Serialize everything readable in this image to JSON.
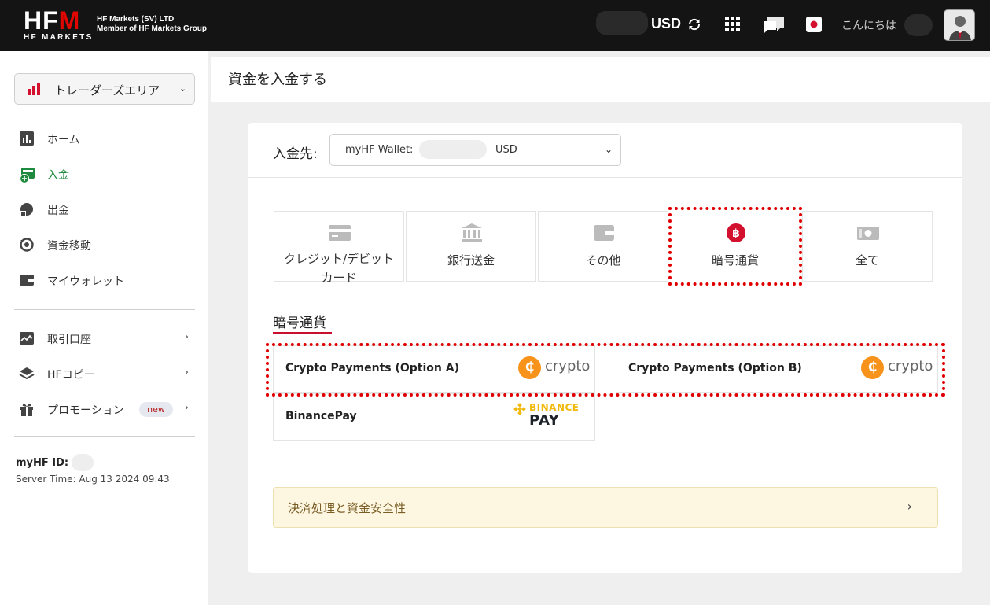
{
  "header": {
    "logo_text": "HFM",
    "logo_subtext": "HF MARKETS",
    "entity_line1": "HF Markets (SV) LTD",
    "entity_line2": "Member of HF Markets Group",
    "currency": "USD",
    "greeting": "こんにちは",
    "icons": [
      "refresh-icon",
      "apps-grid-icon",
      "chat-icon",
      "japan-flag-icon",
      "user-avatar"
    ]
  },
  "sidebar": {
    "area_button": "トレーダーズエリア",
    "items": [
      {
        "label": "ホーム",
        "icon": "chart-icon"
      },
      {
        "label": "入金",
        "icon": "deposit-wallet-icon",
        "active": true
      },
      {
        "label": "出金",
        "icon": "withdraw-icon"
      },
      {
        "label": "資金移動",
        "icon": "transfer-icon"
      },
      {
        "label": "マイウォレット",
        "icon": "wallet-icon"
      }
    ],
    "items2": [
      {
        "label": "取引口座",
        "icon": "trading-account-icon"
      },
      {
        "label": "HFコピー",
        "icon": "layers-icon"
      },
      {
        "label": "プロモーション",
        "icon": "gift-icon",
        "badge": "new"
      }
    ],
    "myhf_id_label": "myHF ID:",
    "server_time": "Server Time: Aug 13 2024 09:43"
  },
  "page": {
    "title": "資金を入金する"
  },
  "deposit": {
    "destination_label": "入金先:",
    "wallet_label": "myHF Wallet:",
    "wallet_currency": "USD",
    "tabs": [
      {
        "label": "クレジット/デビットカード",
        "icon": "credit-card-icon"
      },
      {
        "label": "銀行送金",
        "icon": "bank-icon"
      },
      {
        "label": "その他",
        "icon": "wallet-icon"
      },
      {
        "label": "暗号通貨",
        "icon": "bitcoin-icon",
        "selected": true
      },
      {
        "label": "全て",
        "icon": "cash-icon"
      }
    ],
    "section_title": "暗号通貨",
    "methods": [
      {
        "label": "Crypto Payments (Option A)",
        "logo_text": "crypto"
      },
      {
        "label": "Crypto Payments (Option B)",
        "logo_text": "crypto"
      },
      {
        "label": "BinancePay",
        "logo_line1": "BINANCE",
        "logo_line2": "PAY"
      }
    ],
    "notice": "決済処理と資金安全性"
  },
  "colors": {
    "brand_red": "#e10600",
    "active_green": "#1e8a3d",
    "highlight_dotted": "#e00000",
    "crypto_orange": "#f7931a",
    "binance_yellow": "#f0b90b"
  }
}
